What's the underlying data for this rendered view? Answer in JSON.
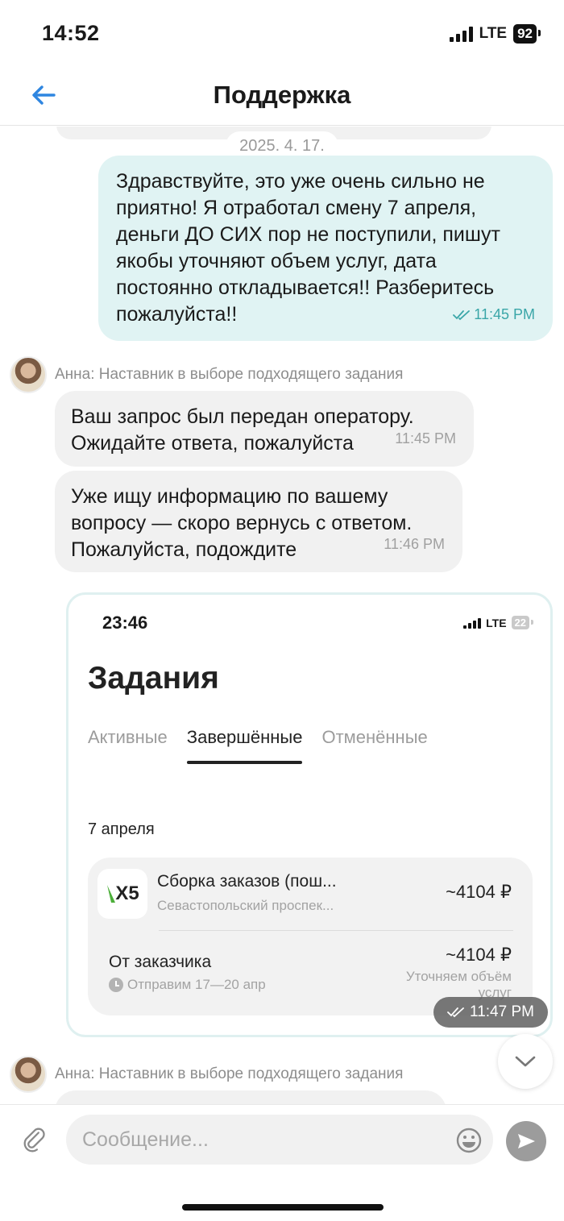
{
  "status_bar": {
    "time": "14:52",
    "network": "LTE",
    "battery": "92"
  },
  "nav": {
    "title": "Поддержка"
  },
  "chat": {
    "date_separator": "2025. 4. 17.",
    "outgoing_message": {
      "text": "Здравствуйте, это уже очень сильно не приятно! Я отработал смену 7 апреля, деньги ДО СИХ пор не поступили, пишут якобы уточняют объем услуг, дата постоянно откладывается!! Разберитесь пожалуйста!!",
      "time": "11:45 PM"
    },
    "sender_name": "Анна: Наставник в выборе подходящего задания",
    "incoming_messages": [
      {
        "text": "Ваш запрос был передан оператору. Ожидайте ответа, пожалуйста",
        "time": "11:45 PM"
      },
      {
        "text": "Уже ищу информацию по вашему вопросу — скоро вернусь с ответом. Пожалуйста, подождите",
        "time": "11:46 PM"
      }
    ],
    "attachment": {
      "time": "11:47 PM",
      "screenshot": {
        "status_time": "23:46",
        "network": "LTE",
        "battery": "22",
        "title": "Задания",
        "tabs": [
          "Активные",
          "Завершённые",
          "Отменённые"
        ],
        "active_tab": "Завершённые",
        "date": "7 апреля",
        "card": {
          "logo": "X5",
          "title": "Сборка заказов (пош...",
          "subtitle": "Севастопольский проспек...",
          "price": "~4104 ₽",
          "from_label": "От заказчика",
          "eta": "Отправим 17—20 апр",
          "price2": "~4104 ₽",
          "note": "Уточняем объём услуг"
        }
      }
    },
    "second_sender_name": "Анна: Наставник в выборе подходящего задания"
  },
  "composer": {
    "placeholder": "Сообщение..."
  },
  "colors": {
    "accent": "#2f86e0",
    "outgoing_bubble": "#e0f3f3",
    "incoming_bubble": "#f1f1f1",
    "read_check": "#3aa6a8"
  }
}
